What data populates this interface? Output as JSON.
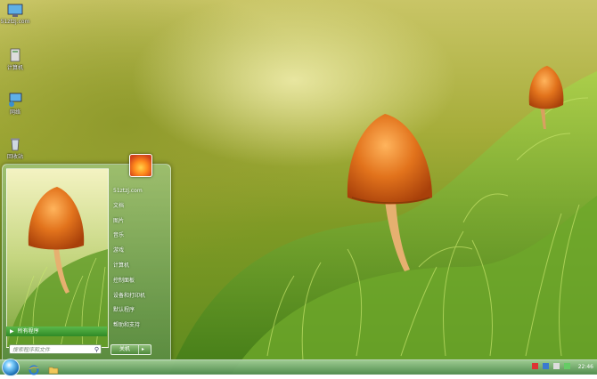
{
  "desktop": {
    "icons": [
      {
        "label": "51ztzj.com",
        "icon": "monitor-icon"
      },
      {
        "label": "计算机",
        "icon": "computer-icon"
      },
      {
        "label": "网络",
        "icon": "network-icon"
      },
      {
        "label": "回收站",
        "icon": "recycle-bin-icon"
      }
    ]
  },
  "start_menu": {
    "all_programs": "所有程序",
    "search_placeholder": "搜索程序和文件",
    "right_items": [
      "51ztzj.com",
      "文档",
      "图片",
      "音乐",
      "游戏",
      "计算机",
      "控制面板",
      "设备和打印机",
      "默认程序",
      "帮助和支持"
    ],
    "shutdown_label": "关机"
  },
  "taskbar": {
    "clock": "22:46",
    "pinned": [
      "ie-icon",
      "folder-icon"
    ]
  },
  "colors": {
    "taskbar": "#5f9a5a",
    "all_programs_bar": "#2f8a26",
    "mushroom": "#e2731c"
  }
}
